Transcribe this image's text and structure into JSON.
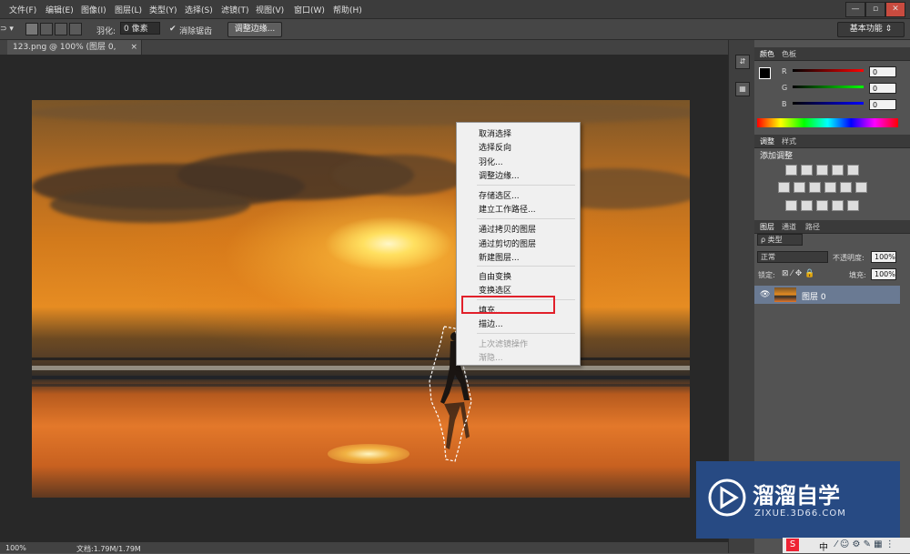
{
  "menubar": {
    "items": [
      "文件(F)",
      "编辑(E)",
      "图像(I)",
      "图层(L)",
      "类型(Y)",
      "选择(S)",
      "滤镜(T)",
      "视图(V)",
      "窗口(W)",
      "帮助(H)"
    ],
    "win_buttons": [
      "—",
      "▫",
      "✕"
    ]
  },
  "options": {
    "feather_label": "羽化:",
    "feather_value": "0 像素",
    "antialias_label": "消除锯齿",
    "refine_edge": "调整边缘...",
    "workspace": "基本功能"
  },
  "document": {
    "tab": "123.png @ 100% (图层 0, RGB/8)",
    "tab_close": "×"
  },
  "context_menu": {
    "items": [
      "取消选择",
      "选择反向",
      "羽化...",
      "调整边缘...",
      "存储选区...",
      "建立工作路径...",
      "通过拷贝的图层",
      "通过剪切的图层",
      "新建图层...",
      "自由变换",
      "变换选区",
      "填充...",
      "描边...",
      "上次滤镜操作",
      "渐隐..."
    ]
  },
  "color_panel": {
    "tabs": [
      "颜色",
      "色板"
    ],
    "channels": [
      "R",
      "G",
      "B"
    ],
    "values": [
      "0",
      "0",
      "0"
    ]
  },
  "adjust_panel": {
    "tabs": [
      "调整",
      "样式"
    ],
    "title": "添加调整"
  },
  "layers_panel": {
    "tabs": [
      "图层",
      "通道",
      "路径"
    ],
    "filter": "ρ 类型",
    "blend_mode": "正常",
    "opacity_label": "不透明度:",
    "opacity_value": "100%",
    "lock_label": "锁定:",
    "fill_label": "填充:",
    "fill_value": "100%",
    "layer_name": "图层 0"
  },
  "status": {
    "zoom": "100%",
    "doc_info": "文档:1.79M/1.79M"
  },
  "watermark": {
    "title": "溜溜自学",
    "url": "ZIXUE.3D66.COM"
  },
  "tray": {
    "ime": "中"
  },
  "colors": {
    "highlight_border": "#e1202a",
    "watermark_bg": "#274a83",
    "layer_selected": "#6a7a93"
  }
}
